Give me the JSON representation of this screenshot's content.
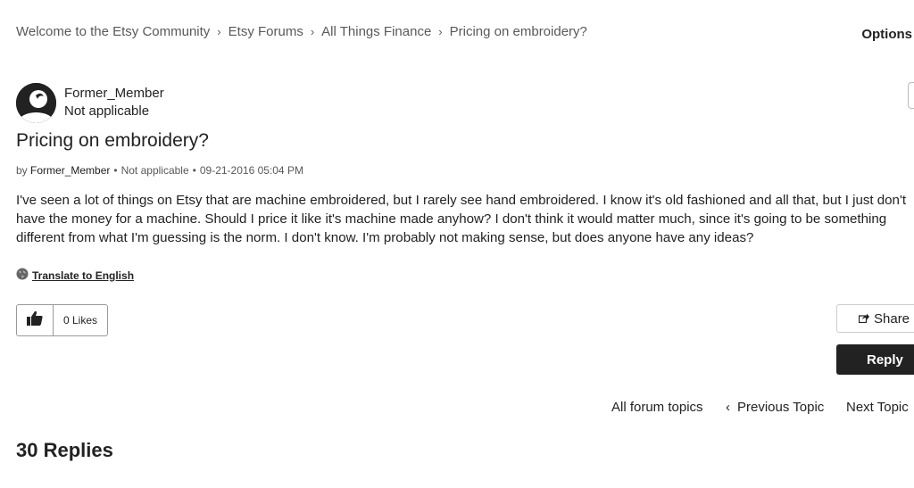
{
  "breadcrumb": [
    {
      "label": "Welcome to the Etsy Community"
    },
    {
      "label": "Etsy Forums"
    },
    {
      "label": "All Things Finance"
    },
    {
      "label": "Pricing on embroidery?"
    }
  ],
  "breadcrumb_separator": "›",
  "header": {
    "options_label": "Options"
  },
  "author": {
    "name": "Former_Member",
    "role": "Not applicable"
  },
  "post": {
    "title": "Pricing on embroidery?",
    "meta": {
      "by_prefix": "by",
      "author": "Former_Member",
      "role": "Not applicable",
      "dot": "•",
      "timestamp": "09-21-2016 05:04 PM"
    },
    "body": "I've seen a lot of things on Etsy that are machine embroidered, but I rarely see hand embroidered. I know it's old fashioned and all that, but I just don't have the money for a machine. Should I price it like it's machine made anyhow? I don't think it would matter much, since it's going to be something different from what I'm guessing is the norm. I don't know. I'm probably not making sense, but does anyone have any ideas?",
    "translate_label": "Translate to English"
  },
  "kudos": {
    "count_label": "0 Likes",
    "icon": "thumbs-up-icon"
  },
  "actions": {
    "share_label": "Share",
    "share_icon": "share-icon",
    "reply_label": "Reply"
  },
  "topic_nav": {
    "all_label": "All forum topics",
    "prev_arrow": "‹",
    "prev_label": "Previous Topic",
    "next_label": "Next Topic"
  },
  "replies": {
    "heading": "30 Replies"
  }
}
